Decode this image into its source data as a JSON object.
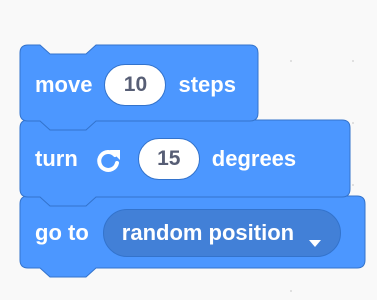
{
  "colors": {
    "motion_block": "#4c97ff",
    "motion_border": "#3373cc",
    "dropdown_fill": "#4280d7",
    "input_text": "#575e75",
    "canvas": "#f9f9f9"
  },
  "blocks": [
    {
      "opcode_label_1": "move",
      "input_value": "10",
      "opcode_label_2": "steps"
    },
    {
      "opcode_label_1": "turn",
      "icon": "rotate-right-icon",
      "input_value": "15",
      "opcode_label_2": "degrees"
    },
    {
      "opcode_label_1": "go to",
      "dropdown_value": "random position",
      "dropdown_icon": "caret-down-icon"
    }
  ]
}
